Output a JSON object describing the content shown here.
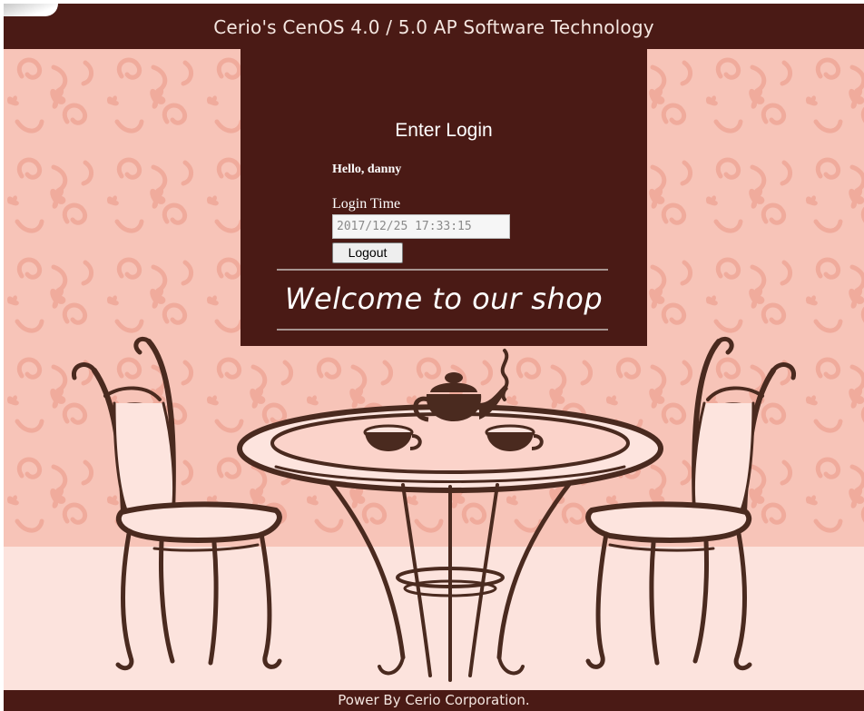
{
  "header": {
    "title": "Cerio's CenOS 4.0 / 5.0 AP Software Technology"
  },
  "login": {
    "title": "Enter Login",
    "greeting": "Hello, danny",
    "login_time_label": "Login Time",
    "login_time_value": "2017/12/25 17:33:15",
    "logout_label": "Logout",
    "welcome_text": "Welcome to our shop"
  },
  "footer": {
    "text": "Power By Cerio Corporation."
  },
  "colors": {
    "panel": "#4a1a15",
    "wallpaper": "#f7c4b8",
    "floor": "#fce3dd",
    "furniture": "#4a2a1f"
  },
  "icons": {
    "teapot": "teapot-icon",
    "cups": "teacup-icon"
  }
}
